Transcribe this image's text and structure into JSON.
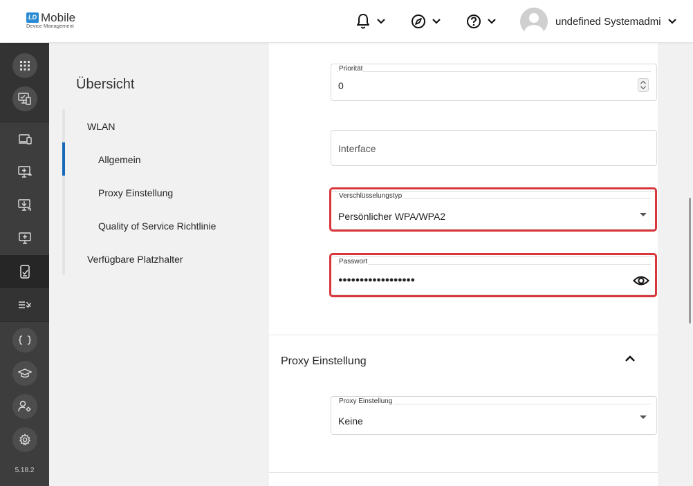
{
  "header": {
    "logo_badge": "LD",
    "logo_name": "Mobile",
    "logo_sub": "Device Management",
    "user_name": "undefined Systemadmi…"
  },
  "sidebar": {
    "version": "5.18.2",
    "items": [
      {
        "icon": "grid-icon"
      },
      {
        "icon": "monitor-devices-icon"
      },
      {
        "icon": "devices-icon"
      },
      {
        "icon": "screen-forward-icon"
      },
      {
        "icon": "download-tray-icon"
      },
      {
        "icon": "monitor-add-icon"
      },
      {
        "icon": "mobile-policy-icon"
      },
      {
        "icon": "list-check-icon"
      },
      {
        "icon": "braces-icon"
      },
      {
        "icon": "graduation-cap-icon"
      },
      {
        "icon": "user-settings-icon"
      },
      {
        "icon": "gear-icon"
      }
    ]
  },
  "overview": {
    "title": "Übersicht",
    "items": {
      "wlan": "WLAN",
      "allgemein": "Allgemein",
      "proxy": "Proxy Einstellung",
      "qos": "Quality of Service Richtlinie",
      "placeholders": "Verfügbare Platzhalter"
    }
  },
  "form": {
    "prioritaet": {
      "label": "Priorität",
      "value": "0"
    },
    "interface": {
      "placeholder": "Interface"
    },
    "verschluesselung": {
      "label": "Verschlüsselungstyp",
      "value": "Persönlicher WPA/WPA2"
    },
    "passwort": {
      "label": "Passwort",
      "value": "●●●●●●●●●●●●●●●●●●"
    },
    "proxy_section": {
      "title": "Proxy Einstellung",
      "field_label": "Proxy Einstellung",
      "field_value": "Keine"
    }
  },
  "colors": {
    "highlight": "#d9363b",
    "active_nav": "#1669b7",
    "sidebar_bg": "#3d3d3d"
  }
}
